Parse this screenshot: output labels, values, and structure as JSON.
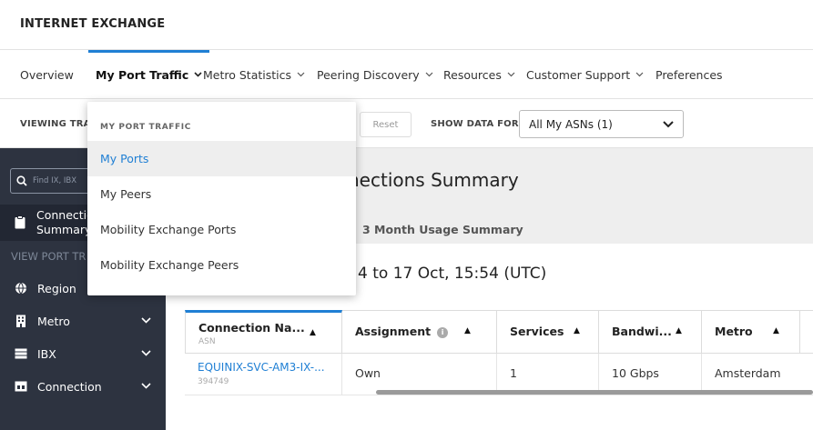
{
  "app": {
    "title": "INTERNET EXCHANGE"
  },
  "nav": {
    "items": [
      {
        "label": "Overview",
        "chev": ""
      },
      {
        "label": "My Port Traffic",
        "chev": "⌄"
      },
      {
        "label": "Metro Statistics",
        "chev": "⌄"
      },
      {
        "label": "Peering Discovery",
        "chev": "⌄"
      },
      {
        "label": "Resources",
        "chev": "⌄"
      },
      {
        "label": "Customer Support",
        "chev": "⌄"
      },
      {
        "label": "Preferences",
        "chev": ""
      }
    ]
  },
  "filterbar": {
    "viewing_label": "VIEWING TRAI",
    "reset_label": "Reset",
    "show_data_label": "SHOW DATA FOR:",
    "asn_selected": "All My ASNs (1)"
  },
  "dropdown": {
    "header": "MY PORT TRAFFIC",
    "items": [
      "My Ports",
      "My Peers",
      "Mobility Exchange Ports",
      "Mobility Exchange Peers"
    ]
  },
  "sidebar": {
    "search_placeholder": "Find IX, IBX",
    "active_line1": "Connectio",
    "active_line2": "Summary",
    "section_label": "VIEW PORT TR",
    "items": [
      {
        "label": "Region",
        "icon": "globe-icon"
      },
      {
        "label": "Metro",
        "icon": "building-icon"
      },
      {
        "label": "IBX",
        "icon": "server-icon"
      },
      {
        "label": "Connection",
        "icon": "connection-icon"
      }
    ]
  },
  "main": {
    "title": "nections Summary",
    "tab_label": "3 Month Usage Summary",
    "date_range": "4 to 17 Oct, 15:54 (UTC)"
  },
  "table": {
    "columns": [
      {
        "label": "Connection Na...",
        "sub": "ASN"
      },
      {
        "label": "Assignment",
        "sub": ""
      },
      {
        "label": "Services",
        "sub": ""
      },
      {
        "label": "Bandwi...",
        "sub": ""
      },
      {
        "label": "Metro",
        "sub": ""
      }
    ],
    "rows": [
      {
        "connection": "EQUINIX-SVC-AM3-IX-...",
        "asn": "394749",
        "assignment": "Own",
        "services": "1",
        "bandwidth": "10 Gbps",
        "metro": "Amsterdam"
      }
    ]
  },
  "colors": {
    "accent": "#1f7fd4",
    "sidebar_bg": "#2d3340"
  }
}
